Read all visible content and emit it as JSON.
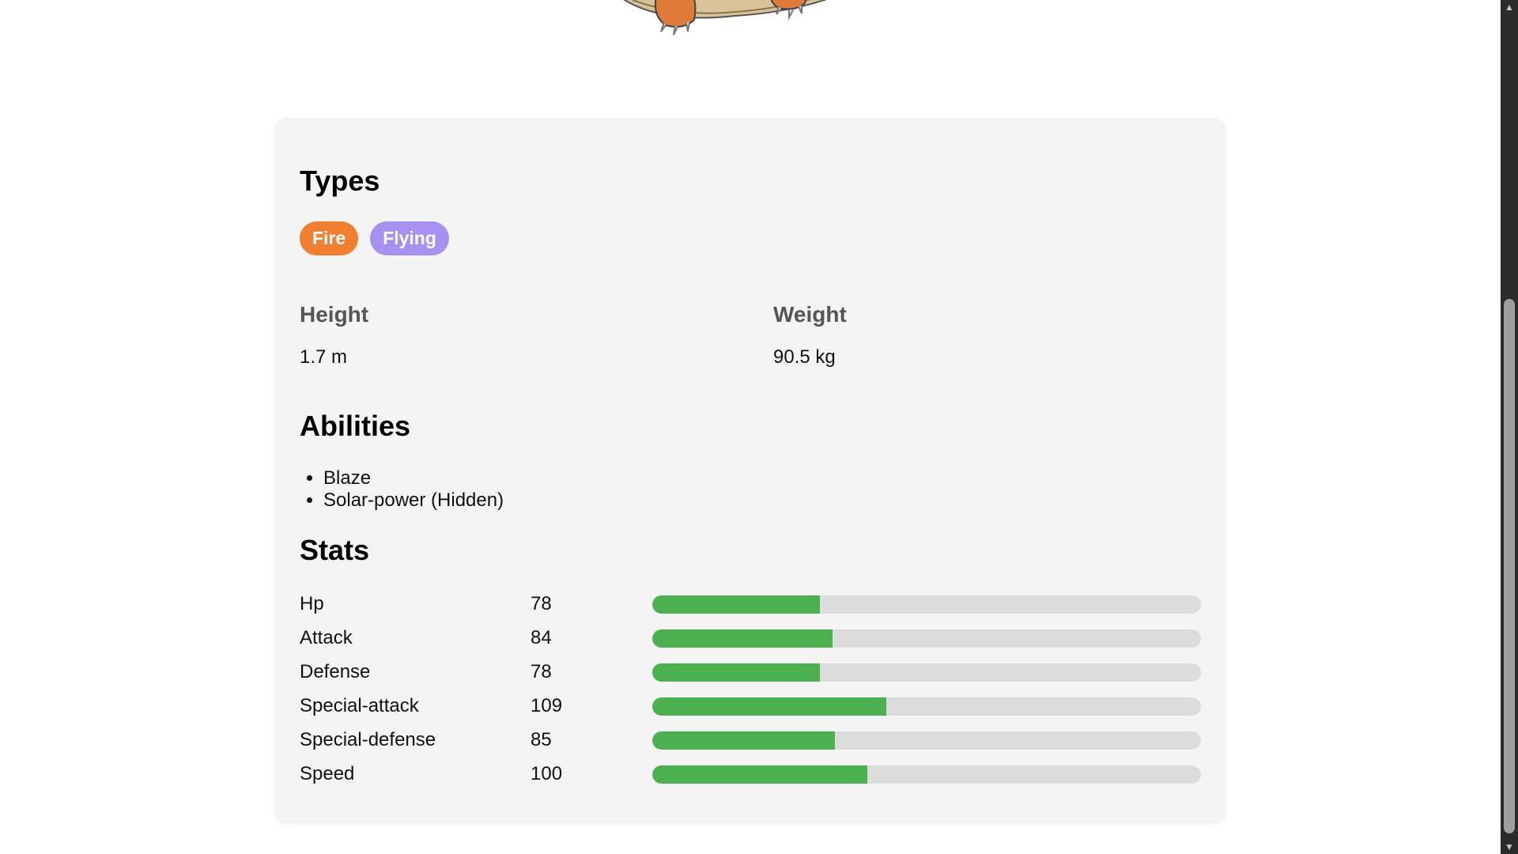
{
  "pokemon": {
    "sprite_icon": "charizard-sprite",
    "types_title": "Types",
    "types": [
      {
        "label": "Fire",
        "color": "#f08030"
      },
      {
        "label": "Flying",
        "color": "#a890f0"
      }
    ],
    "height_label": "Height",
    "height_value": "1.7 m",
    "weight_label": "Weight",
    "weight_value": "90.5 kg",
    "abilities_title": "Abilities",
    "abilities": [
      "Blaze",
      "Solar-power (Hidden)"
    ],
    "stats_title": "Stats",
    "stats": [
      {
        "name": "Hp",
        "value": "78",
        "fill_pct": 30.6
      },
      {
        "name": "Attack",
        "value": "84",
        "fill_pct": 32.9
      },
      {
        "name": "Defense",
        "value": "78",
        "fill_pct": 30.6
      },
      {
        "name": "Special-attack",
        "value": "109",
        "fill_pct": 42.7
      },
      {
        "name": "Special-defense",
        "value": "85",
        "fill_pct": 33.3
      },
      {
        "name": "Speed",
        "value": "100",
        "fill_pct": 39.2
      }
    ],
    "bar_fill_color": "#4caf50",
    "bar_track_color": "#dcdcdc"
  },
  "scrollbar": {
    "up_icon": "arrow-up-icon",
    "down_icon": "arrow-down-icon"
  }
}
